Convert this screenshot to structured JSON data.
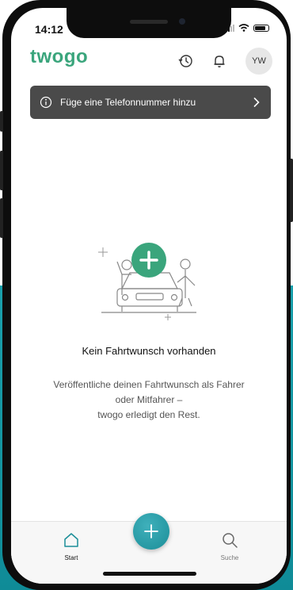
{
  "status_bar": {
    "time": "14:12"
  },
  "header": {
    "logo_text": "twogo",
    "icons": [
      "history-icon",
      "bell-icon"
    ],
    "avatar_initials": "YW"
  },
  "banner": {
    "text": "Füge eine Telefonnummer hinzu",
    "icon": "info-icon"
  },
  "empty_state": {
    "title": "Kein Fahrtwunsch vorhanden",
    "line1": "Veröffentliche deinen Fahrtwunsch als Fahrer",
    "line2": "oder Mitfahrer –",
    "line3": "twogo erledigt den Rest."
  },
  "tabbar": {
    "start_label": "Start",
    "search_label": "Suche",
    "fab_icon": "plus-icon"
  },
  "colors": {
    "brand_green": "#3aa57c",
    "teal": "#1b8e98",
    "banner_bg": "#4a4a4a",
    "active_tab": "#1b8e98"
  }
}
